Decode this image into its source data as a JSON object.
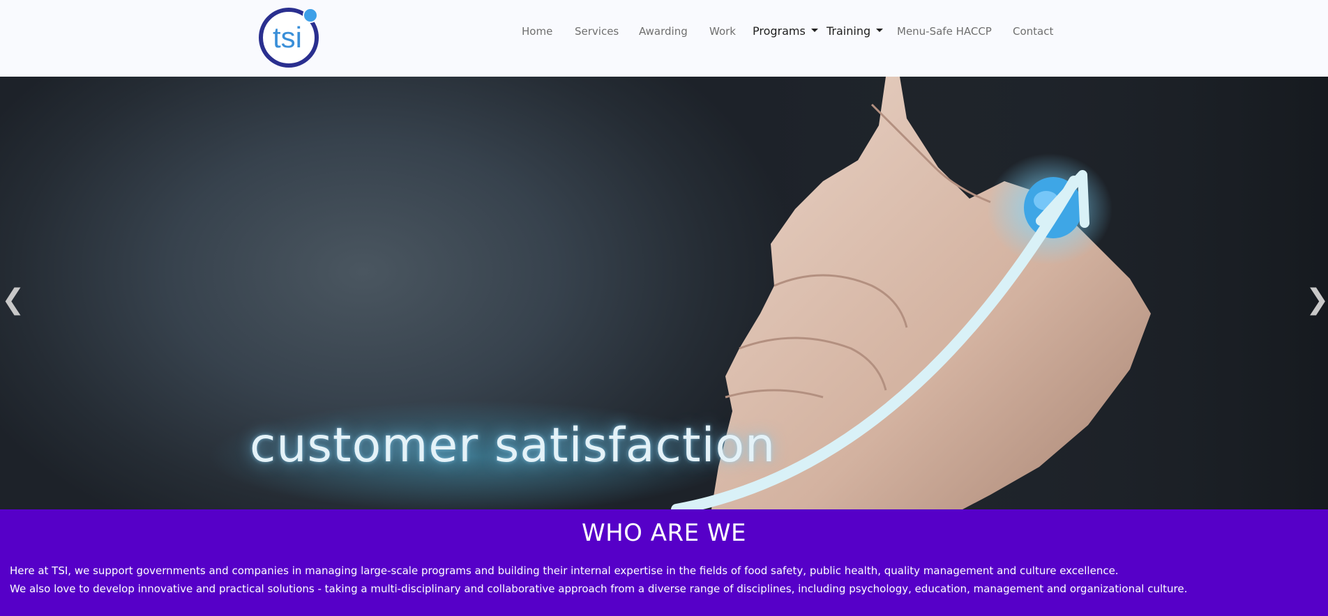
{
  "logo": {
    "text": "tsi",
    "icon": "tsi-logo",
    "primary_color": "#2a2f8f",
    "accent_color": "#3ea0e8"
  },
  "nav": {
    "items": [
      {
        "label": "Home"
      },
      {
        "label": "Services"
      },
      {
        "label": "Awarding"
      },
      {
        "label": "Work"
      },
      {
        "label": "Programs",
        "dropdown": true
      },
      {
        "label": "Training",
        "dropdown": true
      },
      {
        "label": "Menu-Safe HACCP"
      },
      {
        "label": "Contact"
      }
    ]
  },
  "hero": {
    "caption": "customer satisfaction",
    "prev_icon": "chevron-left-icon",
    "prev_symbol": "❮",
    "next_icon": "chevron-right-icon",
    "next_symbol": "❯"
  },
  "about": {
    "title": "WHO ARE WE",
    "line1": "Here at TSI, we support governments and companies in managing large-scale programs and building their internal expertise in the fields of food safety, public health, quality management and culture excellence.",
    "line2": "We also love to develop innovative and practical solutions - taking a multi-disciplinary and collaborative approach from a diverse range of disciplines, including psychology, education, management and organizational culture.",
    "background_color": "#5600c8"
  }
}
